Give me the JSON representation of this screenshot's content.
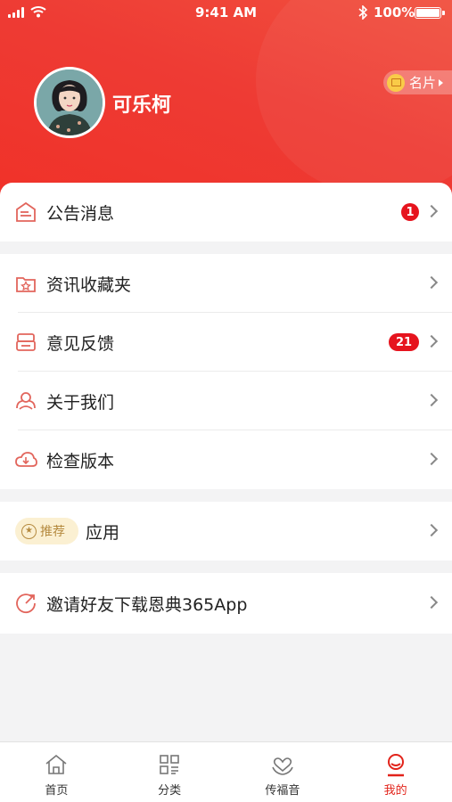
{
  "status_bar": {
    "time": "9:41 AM",
    "battery": "100%"
  },
  "profile": {
    "username": "可乐柯",
    "card_label": "名片"
  },
  "menu": {
    "announcements": {
      "label": "公告消息",
      "badge": "1"
    },
    "favorites": {
      "label": "资讯收藏夹"
    },
    "feedback": {
      "label": "意见反馈",
      "badge": "21"
    },
    "about": {
      "label": "关于我们"
    },
    "check_version": {
      "label": "检查版本"
    },
    "apps": {
      "tag": "推荐",
      "label": "应用"
    },
    "invite": {
      "label": "邀请好友下载恩典365App"
    }
  },
  "tabbar": {
    "items": [
      {
        "label": "首页",
        "icon": "home-icon",
        "active": false
      },
      {
        "label": "分类",
        "icon": "category-grid-icon",
        "active": false
      },
      {
        "label": "传福音",
        "icon": "heart-hands-icon",
        "active": false
      },
      {
        "label": "我的",
        "icon": "profile-icon",
        "active": true
      }
    ]
  },
  "colors": {
    "brand_red": "#ee3b34",
    "badge_red": "#e6141e",
    "active_tab": "#e2231a",
    "tag_bg": "#fbf0d2"
  }
}
